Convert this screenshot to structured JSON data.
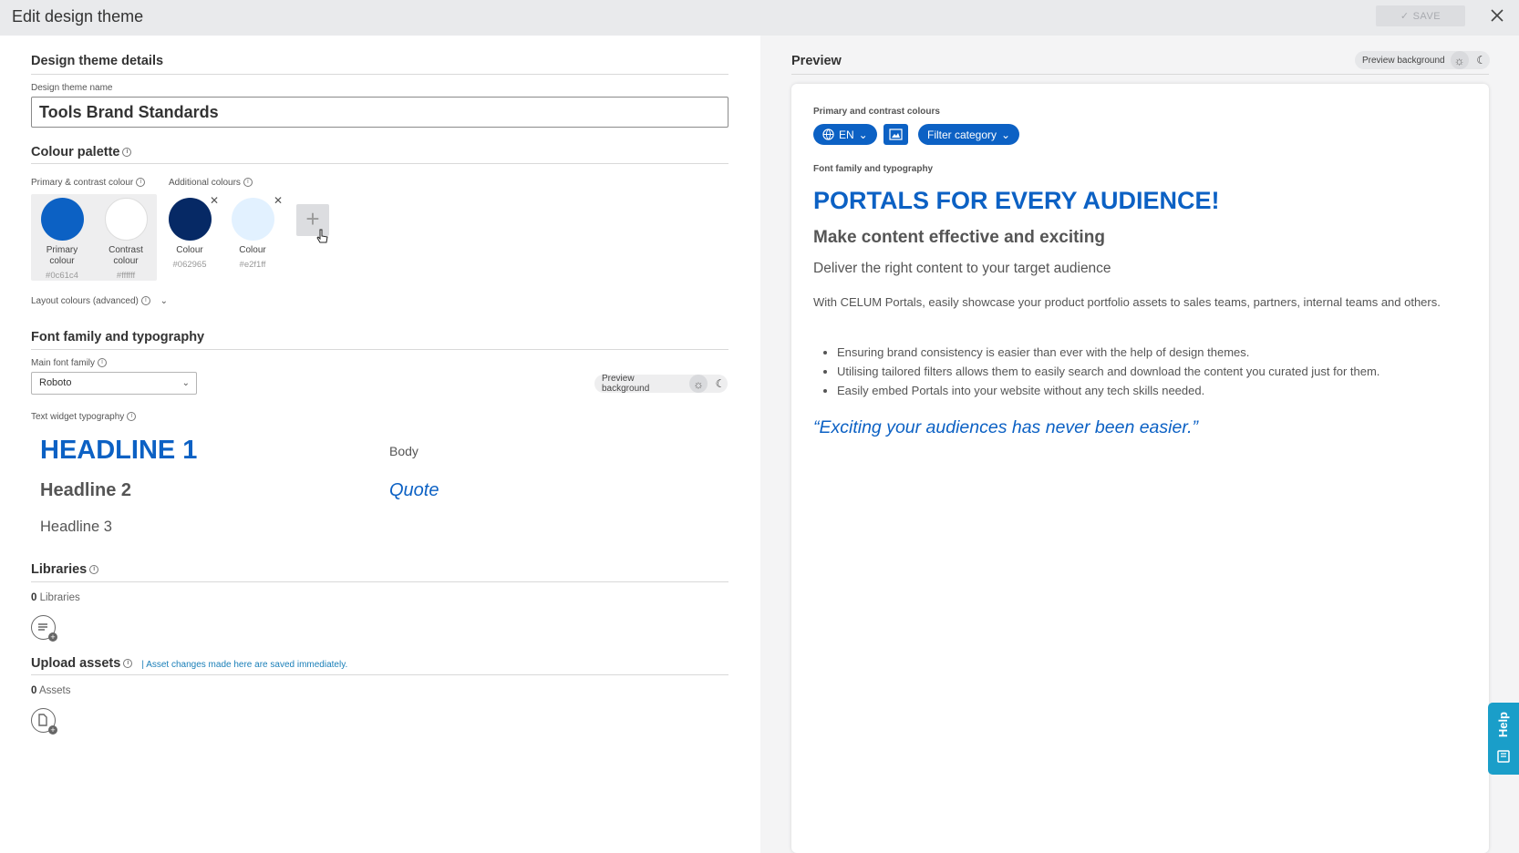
{
  "header": {
    "title": "Edit design theme",
    "save_label": "SAVE"
  },
  "details": {
    "section_title": "Design theme details",
    "name_label": "Design theme name",
    "name_value": "Tools Brand Standards"
  },
  "palette": {
    "section_title": "Colour palette",
    "primary_group_label": "Primary & contrast colour",
    "additional_group_label": "Additional colours",
    "swatches": [
      {
        "label_line1": "Primary",
        "label_line2": "colour",
        "hex": "#0c61c4",
        "color": "#0c61c4"
      },
      {
        "label_line1": "Contrast",
        "label_line2": "colour",
        "hex": "#ffffff",
        "color": "#ffffff"
      },
      {
        "label_line1": "Colour",
        "hex": "#062965",
        "color": "#062965"
      },
      {
        "label_line1": "Colour",
        "hex": "#e2f1ff",
        "color": "#e2f1ff"
      }
    ],
    "layout_colours_label": "Layout colours (advanced)"
  },
  "typography": {
    "section_title": "Font family and typography",
    "main_font_label": "Main font family",
    "main_font_value": "Roboto",
    "preview_background_label": "Preview background",
    "text_widget_label": "Text widget typography",
    "headline1": "HEADLINE 1",
    "headline2": "Headline 2",
    "headline3": "Headline 3",
    "body": "Body",
    "quote": "Quote"
  },
  "libraries": {
    "section_title": "Libraries",
    "count": "0",
    "count_label": "Libraries"
  },
  "upload": {
    "section_title": "Upload assets",
    "note": "Asset changes made here are saved immediately.",
    "count": "0",
    "count_label": "Assets"
  },
  "preview": {
    "title": "Preview",
    "background_label": "Preview background",
    "colours_label": "Primary and contrast colours",
    "language_chip": "EN",
    "filter_chip": "Filter category",
    "typo_label": "Font family and typography",
    "h1": "PORTALS FOR EVERY AUDIENCE!",
    "h2": "Make content effective and exciting",
    "h3": "Deliver the right content to your target audience",
    "body": "With CELUM Portals, easily showcase your product portfolio assets to sales teams, partners, internal teams and others.",
    "bullets": [
      "Ensuring brand consistency is easier than ever with the help of design themes.",
      "Utilising tailored filters allows them to easily search and download the content you curated just for them.",
      "Easily embed Portals into your website without any tech skills needed."
    ],
    "quote": "“Exciting your audiences has never been easier.”"
  },
  "help": {
    "label": "Help"
  },
  "colors": {
    "primary": "#0c61c4",
    "dark": "#062965",
    "light": "#e2f1ff",
    "help_tab": "#1a9ec9"
  },
  "icons": [
    "check-icon",
    "close-icon",
    "info-icon",
    "plus-icon",
    "chevron-down-icon",
    "sun-icon",
    "moon-icon",
    "globe-icon",
    "image-icon",
    "library-add-icon",
    "file-add-icon",
    "cursor-icon",
    "help-icon"
  ]
}
